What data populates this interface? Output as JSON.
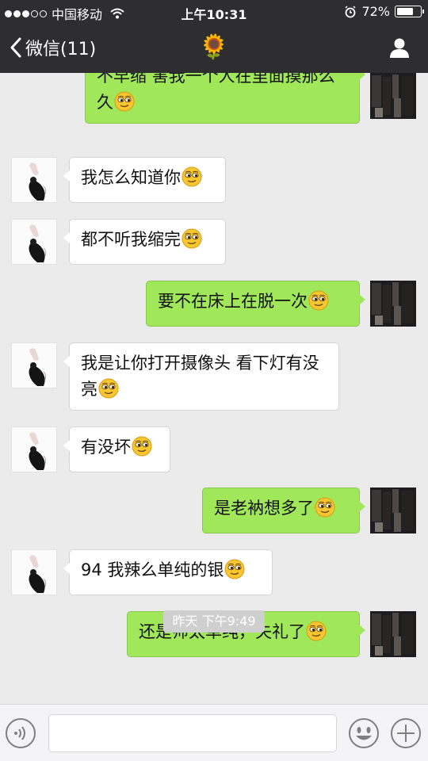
{
  "status_bar": {
    "carrier": "中国移动",
    "time": "上午10:31",
    "battery_percent": "72%",
    "battery_level": 0.72,
    "signal_bars_filled": 3,
    "signal_bars_total": 5
  },
  "nav": {
    "back_label": "微信(11)",
    "title": "🌻"
  },
  "messages": [
    {
      "side": "self",
      "text": "不早缩  害我一个人在里面摸那么久"
    },
    {
      "side": "peer",
      "text": "我怎么知道你"
    },
    {
      "side": "peer",
      "text": "都不听我缩完"
    },
    {
      "side": "self",
      "text": "要不在床上在脱一次"
    },
    {
      "side": "peer",
      "text": "我是让你打开摄像头 看下灯有没亮"
    },
    {
      "side": "peer",
      "text": "有没坏"
    },
    {
      "side": "self",
      "text": "是老衲想多了"
    },
    {
      "side": "peer",
      "text": "94 我辣么单纯的银"
    },
    {
      "side": "self",
      "text": "还是师太单纯，失礼了"
    }
  ],
  "timestamp": "昨天  下午9:49",
  "input": {
    "value": "",
    "placeholder": ""
  },
  "colors": {
    "nav_bg": "#2e2e30",
    "chat_bg": "#ebebeb",
    "self_bubble": "#a0e75a",
    "peer_bubble": "#ffffff",
    "emoji_face": "#f7c631"
  },
  "icons": {
    "back": "chevron-left-icon",
    "profile": "person-icon",
    "voice": "voice-icon",
    "emoji": "smiley-icon",
    "plus": "plus-icon",
    "message_emoji": "sly-face-emoji"
  }
}
